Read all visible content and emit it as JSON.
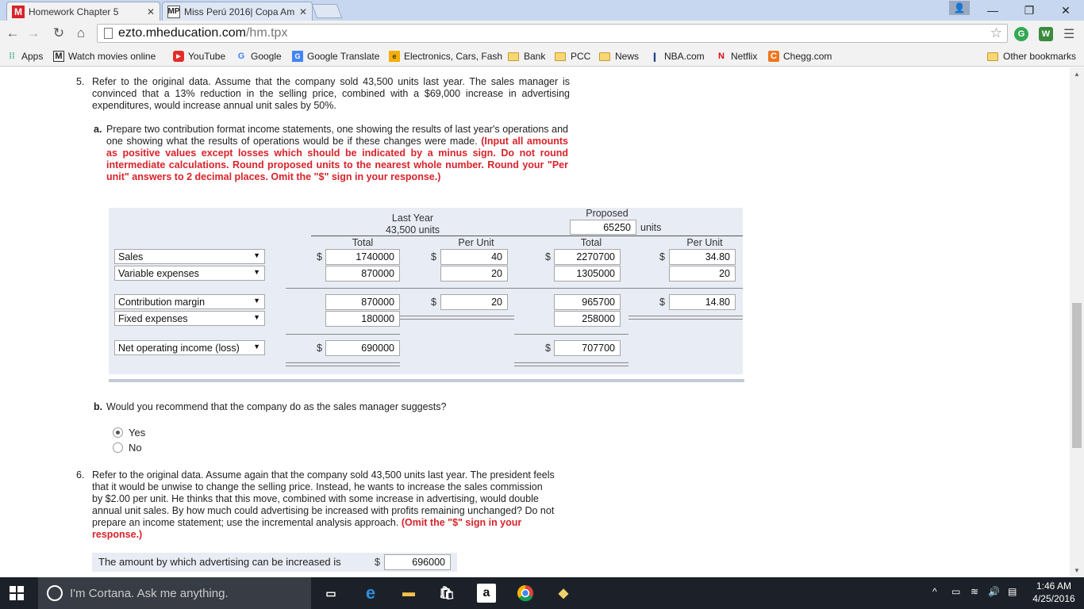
{
  "tabs": [
    {
      "title": "Homework Chapter 5",
      "icon": "M",
      "active": true
    },
    {
      "title": "Miss Perú 2016| Copa Am",
      "icon": "MP",
      "active": false
    }
  ],
  "window": {
    "profile_icon": "person-icon",
    "minimize": "—",
    "restore": "❐",
    "close": "✕"
  },
  "toolbar": {
    "url_host": "ezto.mheducation.com",
    "url_path": "/hm.tpx",
    "ext1": "G",
    "ext2": "W"
  },
  "bookmarks": [
    {
      "label": "Apps",
      "icon": "apps-icon"
    },
    {
      "label": "Watch movies online",
      "icon": "M"
    },
    {
      "label": "YouTube",
      "icon": "youtube-icon"
    },
    {
      "label": "Google",
      "icon": "G"
    },
    {
      "label": "Google Translate",
      "icon": "G"
    },
    {
      "label": "Electronics, Cars, Fash",
      "icon": "ebay-icon"
    },
    {
      "label": "Bank",
      "icon": "folder-icon"
    },
    {
      "label": "PCC",
      "icon": "folder-icon"
    },
    {
      "label": "News",
      "icon": "folder-icon"
    },
    {
      "label": "NBA.com",
      "icon": "nba-icon"
    },
    {
      "label": "Netflix",
      "icon": "N"
    },
    {
      "label": "Chegg.com",
      "icon": "C"
    },
    {
      "label": "Other bookmarks",
      "icon": "folder-icon"
    }
  ],
  "q5": {
    "number": "5.",
    "text": "Refer to the original data. Assume that the company sold 43,500 units last year. The sales manager is convinced that a 13% reduction in the selling price, combined with a $69,000 increase in advertising expenditures, would increase annual unit sales by 50%.",
    "part_a_label": "a.",
    "part_a_text": "Prepare two contribution format income statements, one showing the results of last year's operations and one showing what the results of operations would be if these changes were made.",
    "part_a_instructions": "(Input all amounts as positive values except losses which should be indicated by a minus sign. Do not round intermediate calculations. Round proposed units to the nearest whole number. Round your \"Per unit\" answers to 2 decimal places. Omit the \"$\" sign in your response.)"
  },
  "statement": {
    "last_year_label": "Last Year",
    "last_year_units": "43,500 units",
    "proposed_label": "Proposed",
    "proposed_units": "65250",
    "units_label": "units",
    "col_total": "Total",
    "col_per_unit": "Per Unit",
    "dollar": "$",
    "rows": [
      {
        "label": "Sales",
        "ly_total": "1740000",
        "ly_unit": "40",
        "pr_total": "2270700",
        "pr_unit": "34.80"
      },
      {
        "label": "Variable expenses",
        "ly_total": "870000",
        "ly_unit": "20",
        "pr_total": "1305000",
        "pr_unit": "20"
      },
      {
        "label": "Contribution margin",
        "ly_total": "870000",
        "ly_unit": "20",
        "pr_total": "965700",
        "pr_unit": "14.80"
      },
      {
        "label": "Fixed expenses",
        "ly_total": "180000",
        "pr_total": "258000"
      },
      {
        "label": "Net operating income (loss)",
        "ly_total": "690000",
        "pr_total": "707700"
      }
    ]
  },
  "part_b": {
    "label": "b.",
    "question": "Would you recommend that the company do as the sales manager suggests?",
    "options": [
      "Yes",
      "No"
    ],
    "selected": "Yes"
  },
  "q6": {
    "number": "6.",
    "text": "Refer to the original data. Assume again that the company sold 43,500 units last year. The president feels that it would be unwise to change the selling price. Instead, he wants to increase the sales commission by $2.00 per unit. He thinks that this move, combined with some increase in advertising, would double annual unit sales. By how much could advertising be increased with profits remaining unchanged? Do not prepare an income statement; use the incremental analysis approach.",
    "instructions": "(Omit the \"$\" sign in your response.)",
    "answer_label": "The amount by which advertising can be increased is",
    "dollar": "$",
    "answer_value": "696000"
  },
  "taskbar": {
    "cortana_placeholder": "I'm Cortana. Ask me anything.",
    "time": "1:46 AM",
    "date": "4/25/2016"
  }
}
